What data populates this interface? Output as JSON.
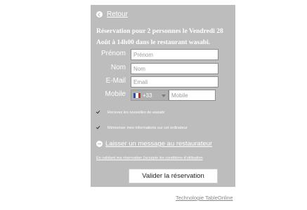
{
  "back": {
    "label": "Retour",
    "icon": "chevron-left-circle-icon"
  },
  "summary": "Réservation pour 2 personnes le Vendredi 28 Août à 14h00 dans le restaurant wasabi.",
  "form": {
    "first_name": {
      "label": "Prénom",
      "placeholder": "Prénom",
      "value": ""
    },
    "last_name": {
      "label": "Nom",
      "placeholder": "Nom",
      "value": ""
    },
    "email": {
      "label": "E-Mail",
      "placeholder": "Email",
      "value": ""
    },
    "phone": {
      "label": "Mobile",
      "country_code": "+33",
      "flag": "flag-france-icon",
      "placeholder": "Mobile",
      "value": ""
    }
  },
  "options": {
    "newsletter": {
      "label": "Recevez les nouvelles de wasabi",
      "checked": true
    },
    "remember": {
      "label": "Mémoriser mes informations sur cet ordinateur",
      "checked": true
    }
  },
  "message_link": {
    "label": "Laisser un message au restaurateur",
    "icon": "minus-circle-icon"
  },
  "conditions": "En validant ma réservation j'accepte les conditions d'utilisation",
  "submit_label": "Valider la réservation",
  "footer": "Technologie TableOnline",
  "colors": {
    "panel_background": "#bdbdbd",
    "text": "#ffffff",
    "footer_text": "#8a8a8a"
  }
}
